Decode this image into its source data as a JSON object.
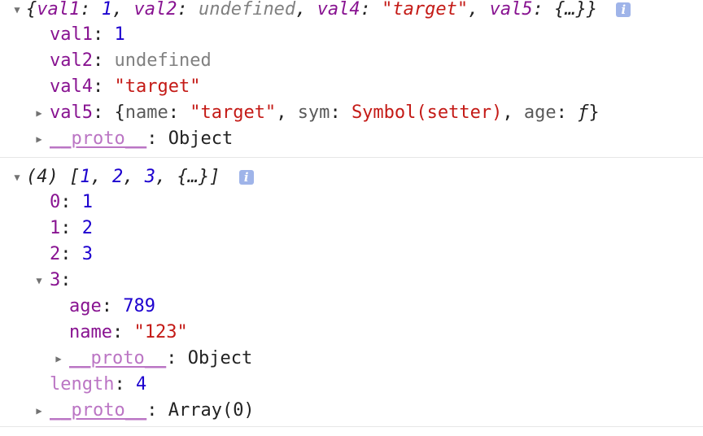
{
  "entry1": {
    "summary": {
      "open": "{",
      "val1_key": "val1",
      "val1_value": "1",
      "val2_key": "val2",
      "val2_value": "undefined",
      "val4_key": "val4",
      "val4_value": "\"target\"",
      "val5_key": "val5",
      "val5_value": "{…}",
      "close": "}"
    },
    "info_glyph": "i",
    "props": {
      "val1": {
        "key": "val1",
        "value": "1"
      },
      "val2": {
        "key": "val2",
        "value": "undefined"
      },
      "val4": {
        "key": "val4",
        "value": "\"target\""
      },
      "val5": {
        "key": "val5",
        "preview_open": "{",
        "name_key": "name",
        "name_value": "\"target\"",
        "sym_key": "sym",
        "sym_value": "Symbol(setter)",
        "age_key": "age",
        "age_value": "ƒ",
        "preview_close": "}"
      },
      "proto": {
        "key": "__proto__",
        "value": "Object"
      }
    }
  },
  "entry2": {
    "summary": {
      "count": "(4)",
      "open": "[",
      "v0": "1",
      "v1": "2",
      "v2": "3",
      "v3": "{…}",
      "close": "]"
    },
    "info_glyph": "i",
    "items": {
      "i0": {
        "key": "0",
        "value": "1"
      },
      "i1": {
        "key": "1",
        "value": "2"
      },
      "i2": {
        "key": "2",
        "value": "3"
      },
      "i3": {
        "key": "3",
        "age_key": "age",
        "age_value": "789",
        "name_key": "name",
        "name_value": "\"123\"",
        "proto_key": "__proto__",
        "proto_value": "Object"
      }
    },
    "length": {
      "key": "length",
      "value": "4"
    },
    "proto": {
      "key": "__proto__",
      "value": "Array(0)"
    }
  },
  "colors": {
    "key": "#881391",
    "number": "#1c00cf",
    "string": "#c41a16",
    "undefined": "#808080",
    "proto": "#bb75c4",
    "info_badge": "#9fb4e9"
  },
  "icons": {
    "expanded": "triangle-down-icon",
    "collapsed": "triangle-right-icon",
    "info": "info-icon"
  }
}
